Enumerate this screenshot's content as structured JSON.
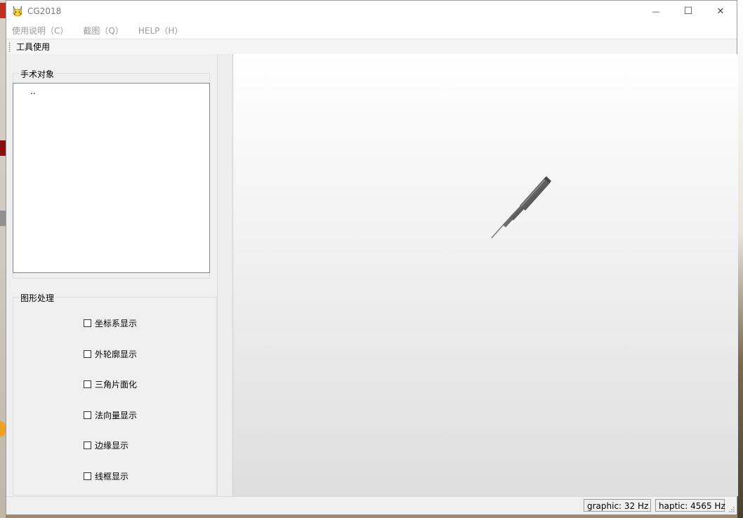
{
  "window": {
    "title": "CG2018",
    "controls": {
      "minimize": "—",
      "maximize": "☐",
      "close": "✕"
    }
  },
  "menubar": {
    "items": [
      {
        "label": "使用说明（C）"
      },
      {
        "label": "截图（Q）"
      },
      {
        "label": "HELP（H）"
      }
    ]
  },
  "toolbar": {
    "label": "工具使用"
  },
  "surgical_objects": {
    "title": "手术对象",
    "tree_items": [
      ".."
    ]
  },
  "graphics": {
    "title": "图形处理",
    "options": [
      {
        "label": "坐标系显示",
        "checked": false
      },
      {
        "label": "外轮廓显示",
        "checked": false
      },
      {
        "label": "三角片面化",
        "checked": false
      },
      {
        "label": "法向量显示",
        "checked": false
      },
      {
        "label": "边缘显示",
        "checked": false
      },
      {
        "label": "线框显示",
        "checked": false
      }
    ]
  },
  "statusbar": {
    "graphic": "graphic:  32 Hz",
    "haptic": "haptic: 4565 Hz"
  },
  "icons": [
    "app-icon",
    "minimize-icon",
    "maximize-icon",
    "close-icon",
    "toolbar-grip-icon",
    "checkbox-icon",
    "size-grip-icon",
    "stylus-tool-model"
  ]
}
